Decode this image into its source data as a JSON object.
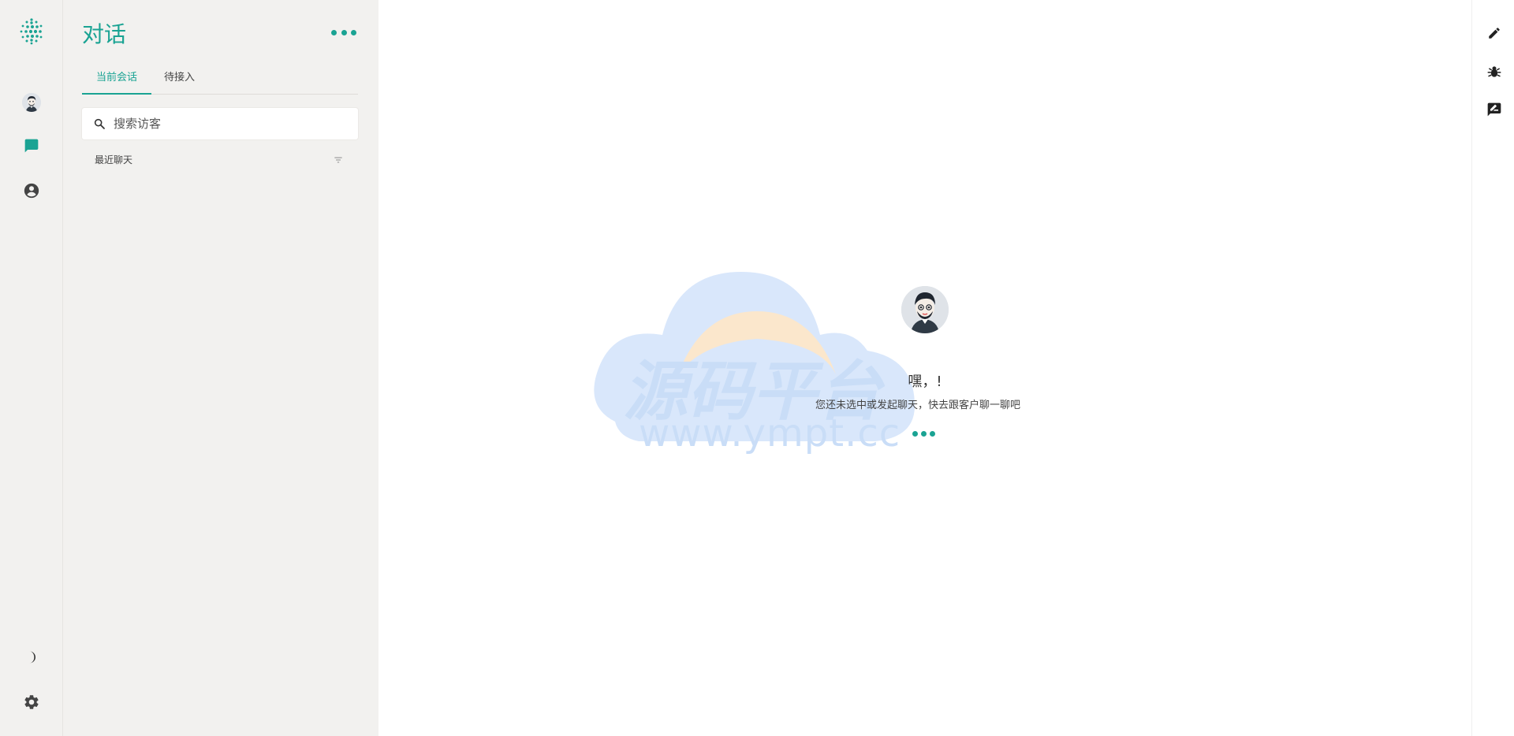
{
  "colors": {
    "accent": "#1aa393",
    "rail_bg": "#f2f1ef",
    "icon": "#444444",
    "watermark": "#c9ddf7"
  },
  "rail": {
    "logo_icon": "dots-sphere-icon",
    "items": [
      {
        "name": "profile",
        "icon": "avatar-icon"
      },
      {
        "name": "chats",
        "icon": "chat-bubble-icon",
        "active": true
      },
      {
        "name": "contacts",
        "icon": "account-circle-icon"
      }
    ],
    "bottom": [
      {
        "name": "theme",
        "icon": "half-moon-icon"
      },
      {
        "name": "settings",
        "icon": "gear-icon"
      }
    ]
  },
  "panel": {
    "title": "对话",
    "tabs": [
      {
        "label": "当前会话",
        "active": true
      },
      {
        "label": "待接入",
        "active": false
      }
    ],
    "search": {
      "placeholder": "搜索访客",
      "value": ""
    },
    "recent_label": "最近聊天"
  },
  "main": {
    "greeting": "嘿，!",
    "subtitle": "您还未选中或发起聊天，快去跟客户聊一聊吧",
    "watermark": {
      "text": "源码平台",
      "url": "www.ympt.cc"
    }
  },
  "toolbar": {
    "items": [
      {
        "name": "edit",
        "icon": "pencil-icon"
      },
      {
        "name": "debug",
        "icon": "bug-icon"
      },
      {
        "name": "note",
        "icon": "rate-review-icon"
      }
    ]
  }
}
